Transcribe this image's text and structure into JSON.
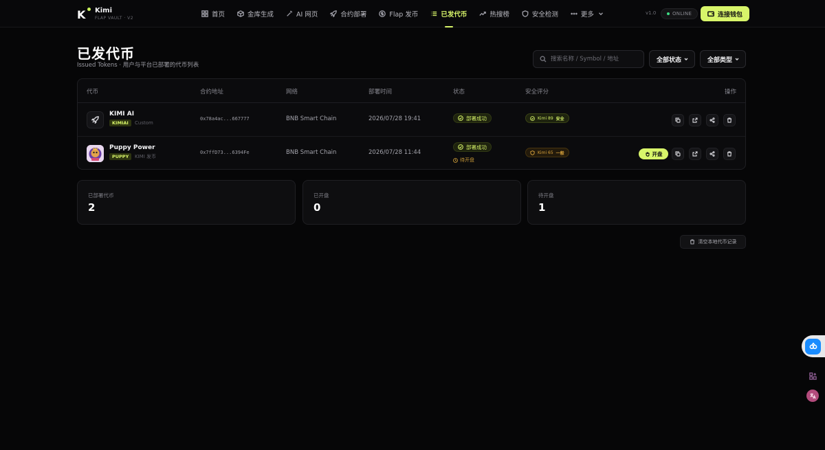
{
  "app": {
    "name": "Kimi",
    "subtitle": "FLAP VAULT · V2",
    "logo_letter": "K"
  },
  "nav": [
    {
      "label": "首页",
      "icon": "grid-icon"
    },
    {
      "label": "金库生成",
      "icon": "cube-icon"
    },
    {
      "label": "AI 网页",
      "icon": "wand-icon"
    },
    {
      "label": "合约部署",
      "icon": "rocket-icon"
    },
    {
      "label": "Flap 发币",
      "icon": "coin-icon"
    },
    {
      "label": "已发代币",
      "icon": "list-icon",
      "active": true
    },
    {
      "label": "热搜榜",
      "icon": "trend-icon"
    },
    {
      "label": "安全检测",
      "icon": "shield-icon"
    },
    {
      "label": "更多",
      "icon": "dots-icon"
    }
  ],
  "header": {
    "version": "v1.0",
    "online": "ONLINE",
    "connect": "连接钱包"
  },
  "page": {
    "title": "已发代币",
    "subtitle": "Issued Tokens · 用户与平台已部署的代币列表"
  },
  "filters": {
    "search_placeholder": "搜索名称 / Symbol / 地址",
    "status": "全部状态",
    "type": "全部类型"
  },
  "table": {
    "columns": [
      "代币",
      "合约地址",
      "网络",
      "部署时间",
      "状态",
      "安全评分",
      "操作"
    ],
    "rows": [
      {
        "name": "KIMI AI",
        "symbol": "KIMIAI",
        "source": "Custom",
        "address": "0x78a4ac...667777",
        "network": "BNB Smart Chain",
        "time": "2026/07/28 19:41",
        "status": "部署成功",
        "score": "Kimi 89",
        "score_level": "安全"
      },
      {
        "name": "Puppy Power",
        "symbol": "PUPPY",
        "source": "KIMI 发币",
        "address": "0x7ffD73...6394Fe",
        "network": "BNB Smart Chain",
        "time": "2026/07/28 11:44",
        "status": "部署成功",
        "pending": "待开盘",
        "score": "Kimi 65",
        "score_level": "一般",
        "open_label": "开盘"
      }
    ]
  },
  "stats": [
    {
      "label": "已部署代币",
      "value": "2"
    },
    {
      "label": "已开盘",
      "value": "0"
    },
    {
      "label": "待开盘",
      "value": "1"
    }
  ],
  "clear_label": "清空本地代币记录",
  "colors": {
    "accent": "#d8f56a",
    "background": "#060607",
    "warning": "#d9a33c"
  }
}
